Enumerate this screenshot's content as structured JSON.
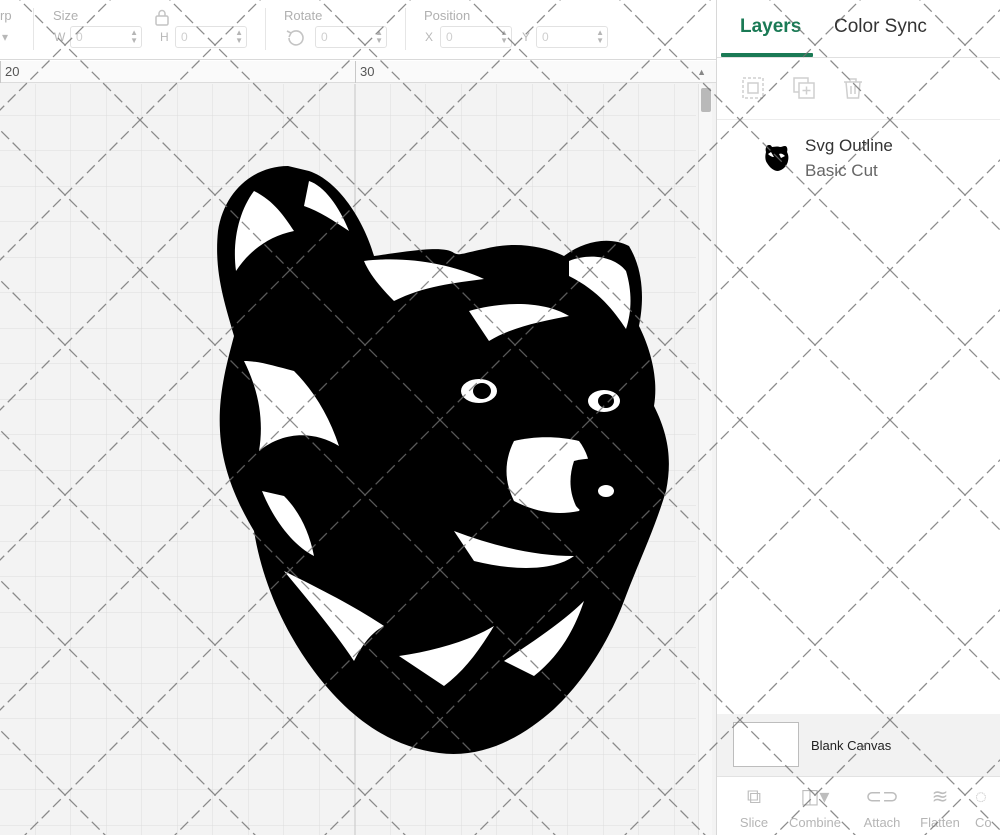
{
  "toolbar": {
    "cut_label": "rp",
    "cut_arrow": "▾",
    "size_label": "Size",
    "w_letter": "W",
    "w_value": "0",
    "h_letter": "H",
    "h_value": "0",
    "rotate_label": "Rotate",
    "rotate_value": "0",
    "position_label": "Position",
    "x_letter": "X",
    "x_value": "0",
    "y_letter": "Y",
    "y_value": "0"
  },
  "ruler": {
    "label_20": "20",
    "label_30": "30"
  },
  "panel": {
    "tabs": [
      {
        "label": "Layers",
        "active": true
      },
      {
        "label": "Color Sync",
        "active": false
      }
    ],
    "layer": {
      "name": "Svg Outline",
      "type": "Basic Cut"
    },
    "blank_canvas_label": "Blank Canvas",
    "bottom_actions": [
      {
        "label": "Slice",
        "icon": "slice-icon"
      },
      {
        "label": "Combine",
        "icon": "combine-icon"
      },
      {
        "label": "Attach",
        "icon": "attach-icon"
      },
      {
        "label": "Flatten",
        "icon": "flatten-icon"
      },
      {
        "label": "Co",
        "icon": "contour-icon"
      }
    ]
  },
  "colors": {
    "accent": "#1a7a55",
    "canvas_bg": "#f3f3f3",
    "grid": "#dcdcdc",
    "bear": "#000000"
  }
}
